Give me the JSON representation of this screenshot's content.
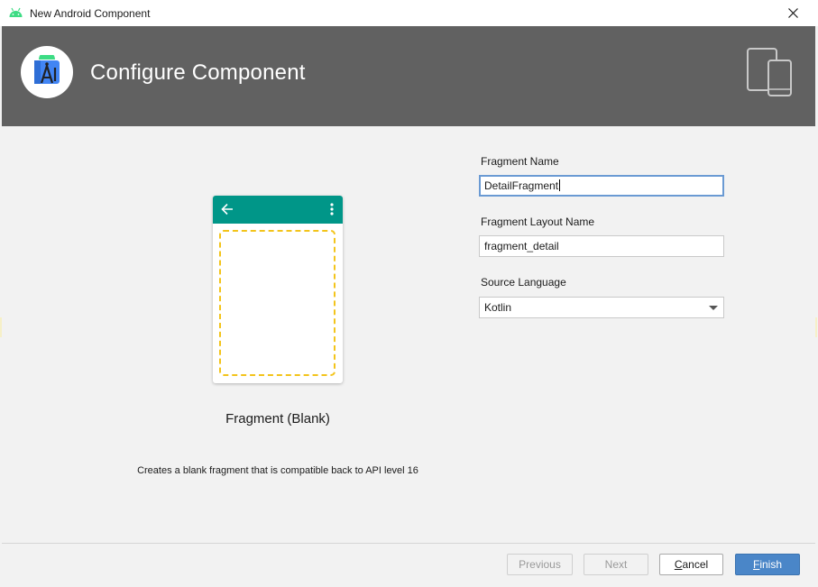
{
  "window": {
    "title": "New Android Component"
  },
  "banner": {
    "heading": "Configure Component"
  },
  "template": {
    "name": "Fragment (Blank)",
    "description": "Creates a blank fragment that is compatible back to API level 16"
  },
  "form": {
    "fragment_name": {
      "label": "Fragment Name",
      "value": "DetailFragment"
    },
    "layout_name": {
      "label": "Fragment Layout Name",
      "value": "fragment_detail"
    },
    "source_language": {
      "label": "Source Language",
      "value": "Kotlin"
    }
  },
  "buttons": {
    "previous": "Previous",
    "next": "Next",
    "cancel_mnemonic": "C",
    "cancel_rest": "ancel",
    "finish_mnemonic": "F",
    "finish_rest": "inish"
  },
  "colors": {
    "banner": "#616161",
    "appbar": "#009688",
    "dashed_frame": "#f3c41b",
    "primary_button": "#4a86c8"
  },
  "icons": {
    "window": "android-head-icon",
    "logo": "android-studio-logo-icon",
    "devices": "phone-tablet-icon",
    "back": "arrow-back-icon",
    "overflow": "more-vert-icon",
    "close": "close-icon",
    "dropdown": "chevron-down-icon"
  }
}
